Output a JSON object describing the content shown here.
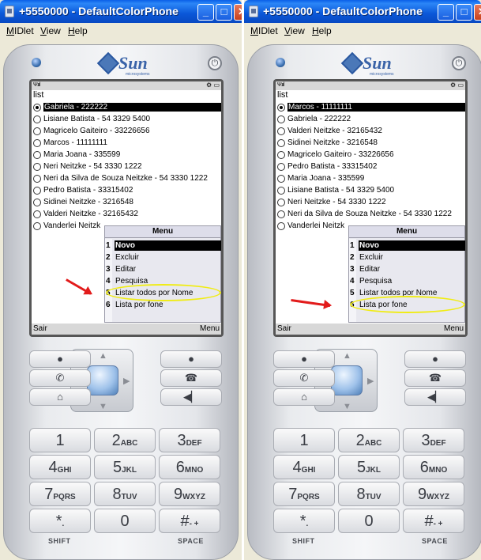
{
  "windows": [
    {
      "title": "+5550000 - DefaultColorPhone",
      "menubar": [
        "MIDlet",
        "View",
        "Help"
      ],
      "screen": {
        "list_title": "list",
        "items": [
          {
            "label": "Gabriela - 222222",
            "selected": true
          },
          {
            "label": "Lisiane Batista - 54 3329 5400",
            "selected": false
          },
          {
            "label": "Magricelo Gaiteiro - 33226656",
            "selected": false
          },
          {
            "label": "Marcos - 11111111",
            "selected": false
          },
          {
            "label": "Maria Joana - 335599",
            "selected": false
          },
          {
            "label": "Neri Neitzke - 54 3330 1222",
            "selected": false
          },
          {
            "label": "Neri da Silva de Souza Neitzke - 54 3330 1222",
            "selected": false
          },
          {
            "label": "Pedro Batista - 33315402",
            "selected": false
          },
          {
            "label": "Sidinei Neitzke - 3216548",
            "selected": false
          },
          {
            "label": "Valderi Neitzke - 32165432",
            "selected": false
          },
          {
            "label": "Vanderlei Neitzk",
            "selected": false
          }
        ],
        "menu": {
          "title": "Menu",
          "items": [
            {
              "num": "1",
              "label": "Novo",
              "selected": true
            },
            {
              "num": "2",
              "label": "Excluir",
              "selected": false
            },
            {
              "num": "3",
              "label": "Editar",
              "selected": false
            },
            {
              "num": "4",
              "label": "Pesquisa",
              "selected": false
            },
            {
              "num": "5",
              "label": "Listar todos por Nome",
              "selected": false
            },
            {
              "num": "6",
              "label": "Lista por fone",
              "selected": false
            }
          ],
          "highlighted_item": "5"
        },
        "soft_left": "Sair",
        "soft_right": "Menu"
      }
    },
    {
      "title": "+5550000 - DefaultColorPhone",
      "menubar": [
        "MIDlet",
        "View",
        "Help"
      ],
      "screen": {
        "list_title": "list",
        "items": [
          {
            "label": "Marcos - 11111111",
            "selected": true
          },
          {
            "label": "Gabriela - 222222",
            "selected": false
          },
          {
            "label": "Valderi Neitzke - 32165432",
            "selected": false
          },
          {
            "label": "Sidinei Neitzke - 3216548",
            "selected": false
          },
          {
            "label": "Magricelo Gaiteiro - 33226656",
            "selected": false
          },
          {
            "label": "Pedro Batista - 33315402",
            "selected": false
          },
          {
            "label": "Maria Joana - 335599",
            "selected": false
          },
          {
            "label": "Lisiane Batista - 54 3329 5400",
            "selected": false
          },
          {
            "label": "Neri Neitzke - 54 3330 1222",
            "selected": false
          },
          {
            "label": "Neri da Silva de Souza Neitzke - 54 3330 1222",
            "selected": false
          },
          {
            "label": "Vanderlei Neitzk",
            "selected": false
          }
        ],
        "menu": {
          "title": "Menu",
          "items": [
            {
              "num": "1",
              "label": "Novo",
              "selected": true
            },
            {
              "num": "2",
              "label": "Excluir",
              "selected": false
            },
            {
              "num": "3",
              "label": "Editar",
              "selected": false
            },
            {
              "num": "4",
              "label": "Pesquisa",
              "selected": false
            },
            {
              "num": "5",
              "label": "Listar todos por Nome",
              "selected": false
            },
            {
              "num": "6",
              "label": "Lista por fone",
              "selected": false
            }
          ],
          "highlighted_item": "6"
        },
        "soft_left": "Sair",
        "soft_right": "Menu"
      }
    }
  ],
  "brand": {
    "name": "Sun",
    "sub": "microsystems"
  },
  "keypad": {
    "keys": [
      {
        "digit": "1",
        "letters": ""
      },
      {
        "digit": "2",
        "letters": "ABC"
      },
      {
        "digit": "3",
        "letters": "DEF"
      },
      {
        "digit": "4",
        "letters": "GHI"
      },
      {
        "digit": "5",
        "letters": "JKL"
      },
      {
        "digit": "6",
        "letters": "MNO"
      },
      {
        "digit": "7",
        "letters": "PQRS"
      },
      {
        "digit": "8",
        "letters": "TUV"
      },
      {
        "digit": "9",
        "letters": "WXYZ"
      },
      {
        "digit": "*",
        "letters": "."
      },
      {
        "digit": "0",
        "letters": ""
      },
      {
        "digit": "#",
        "letters": "- +"
      }
    ],
    "shift_label": "SHIFT",
    "space_label": "SPACE"
  },
  "colors": {
    "titlebar": "#0a57d8",
    "annotation_arrow": "#e21b1b",
    "annotation_ellipse": "#f0ec14",
    "selection": "#000000"
  },
  "icons": {
    "window_icon": "app-icon",
    "minimize": "minimize-icon",
    "maximize": "maximize-icon",
    "close": "close-icon"
  }
}
